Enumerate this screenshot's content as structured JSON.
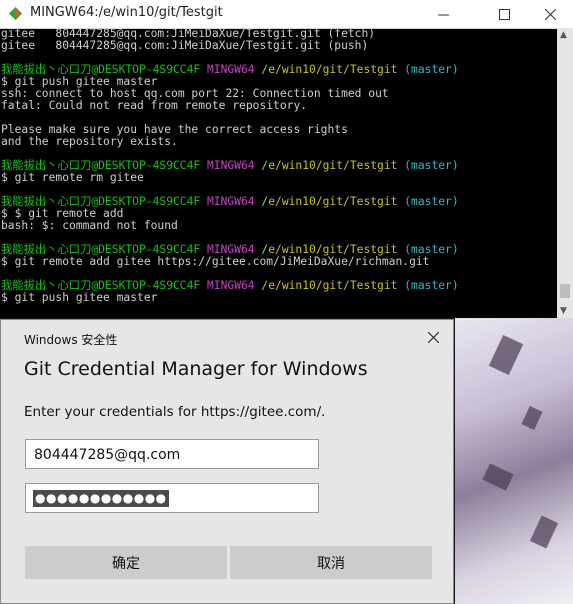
{
  "terminal": {
    "title": "MINGW64:/e/win10/git/Testgit",
    "lines": [
      {
        "segments": [
          {
            "t": "gitee   804447285@qq.com:JiMeiDaXue/Testgit.git (fetch)",
            "c": ""
          }
        ]
      },
      {
        "segments": [
          {
            "t": "gitee   804447285@qq.com:JiMeiDaXue/Testgit.git (push)",
            "c": ""
          }
        ]
      },
      {
        "segments": [
          {
            "t": "",
            "c": ""
          }
        ]
      },
      {
        "segments": [
          {
            "t": "我能拔出丶心口刀@DESKTOP-4S9CC4F ",
            "c": "g"
          },
          {
            "t": "MINGW64 ",
            "c": "m"
          },
          {
            "t": "/e/win10/git/Testgit ",
            "c": "y"
          },
          {
            "t": "(master)",
            "c": "c"
          }
        ]
      },
      {
        "segments": [
          {
            "t": "$ git push gitee master",
            "c": ""
          }
        ]
      },
      {
        "segments": [
          {
            "t": "ssh: connect to host qq.com port 22: Connection timed out",
            "c": ""
          }
        ]
      },
      {
        "segments": [
          {
            "t": "fatal: Could not read from remote repository.",
            "c": ""
          }
        ]
      },
      {
        "segments": [
          {
            "t": "",
            "c": ""
          }
        ]
      },
      {
        "segments": [
          {
            "t": "Please make sure you have the correct access rights",
            "c": ""
          }
        ]
      },
      {
        "segments": [
          {
            "t": "and the repository exists.",
            "c": ""
          }
        ]
      },
      {
        "segments": [
          {
            "t": "",
            "c": ""
          }
        ]
      },
      {
        "segments": [
          {
            "t": "我能拔出丶心口刀@DESKTOP-4S9CC4F ",
            "c": "g"
          },
          {
            "t": "MINGW64 ",
            "c": "m"
          },
          {
            "t": "/e/win10/git/Testgit ",
            "c": "y"
          },
          {
            "t": "(master)",
            "c": "c"
          }
        ]
      },
      {
        "segments": [
          {
            "t": "$ git remote rm gitee",
            "c": ""
          }
        ]
      },
      {
        "segments": [
          {
            "t": "",
            "c": ""
          }
        ]
      },
      {
        "segments": [
          {
            "t": "我能拔出丶心口刀@DESKTOP-4S9CC4F ",
            "c": "g"
          },
          {
            "t": "MINGW64 ",
            "c": "m"
          },
          {
            "t": "/e/win10/git/Testgit ",
            "c": "y"
          },
          {
            "t": "(master)",
            "c": "c"
          }
        ]
      },
      {
        "segments": [
          {
            "t": "$ $ git remote add",
            "c": ""
          }
        ]
      },
      {
        "segments": [
          {
            "t": "bash: $: command not found",
            "c": ""
          }
        ]
      },
      {
        "segments": [
          {
            "t": "",
            "c": ""
          }
        ]
      },
      {
        "segments": [
          {
            "t": "我能拔出丶心口刀@DESKTOP-4S9CC4F ",
            "c": "g"
          },
          {
            "t": "MINGW64 ",
            "c": "m"
          },
          {
            "t": "/e/win10/git/Testgit ",
            "c": "y"
          },
          {
            "t": "(master)",
            "c": "c"
          }
        ]
      },
      {
        "segments": [
          {
            "t": "$ git remote add gitee https://gitee.com/JiMeiDaXue/richman.git",
            "c": ""
          }
        ]
      },
      {
        "segments": [
          {
            "t": "",
            "c": ""
          }
        ]
      },
      {
        "segments": [
          {
            "t": "我能拔出丶心口刀@DESKTOP-4S9CC4F ",
            "c": "g"
          },
          {
            "t": "MINGW64 ",
            "c": "m"
          },
          {
            "t": "/e/win10/git/Testgit ",
            "c": "y"
          },
          {
            "t": "(master)",
            "c": "c"
          }
        ]
      },
      {
        "segments": [
          {
            "t": "$ git push gitee master",
            "c": ""
          }
        ]
      }
    ]
  },
  "dialog": {
    "caption": "Windows 安全性",
    "heading": "Git Credential Manager for Windows",
    "prompt": "Enter your credentials for https://gitee.com/.",
    "username_value": "804447285@qq.com",
    "password_mask": "●●●●●●●●●●●●",
    "ok_label": "确定",
    "cancel_label": "取消"
  },
  "colors": {
    "prompt_user": "#15c515",
    "prompt_mingw": "#c840c8",
    "prompt_path": "#c9c22a",
    "prompt_branch": "#30b8c8"
  }
}
